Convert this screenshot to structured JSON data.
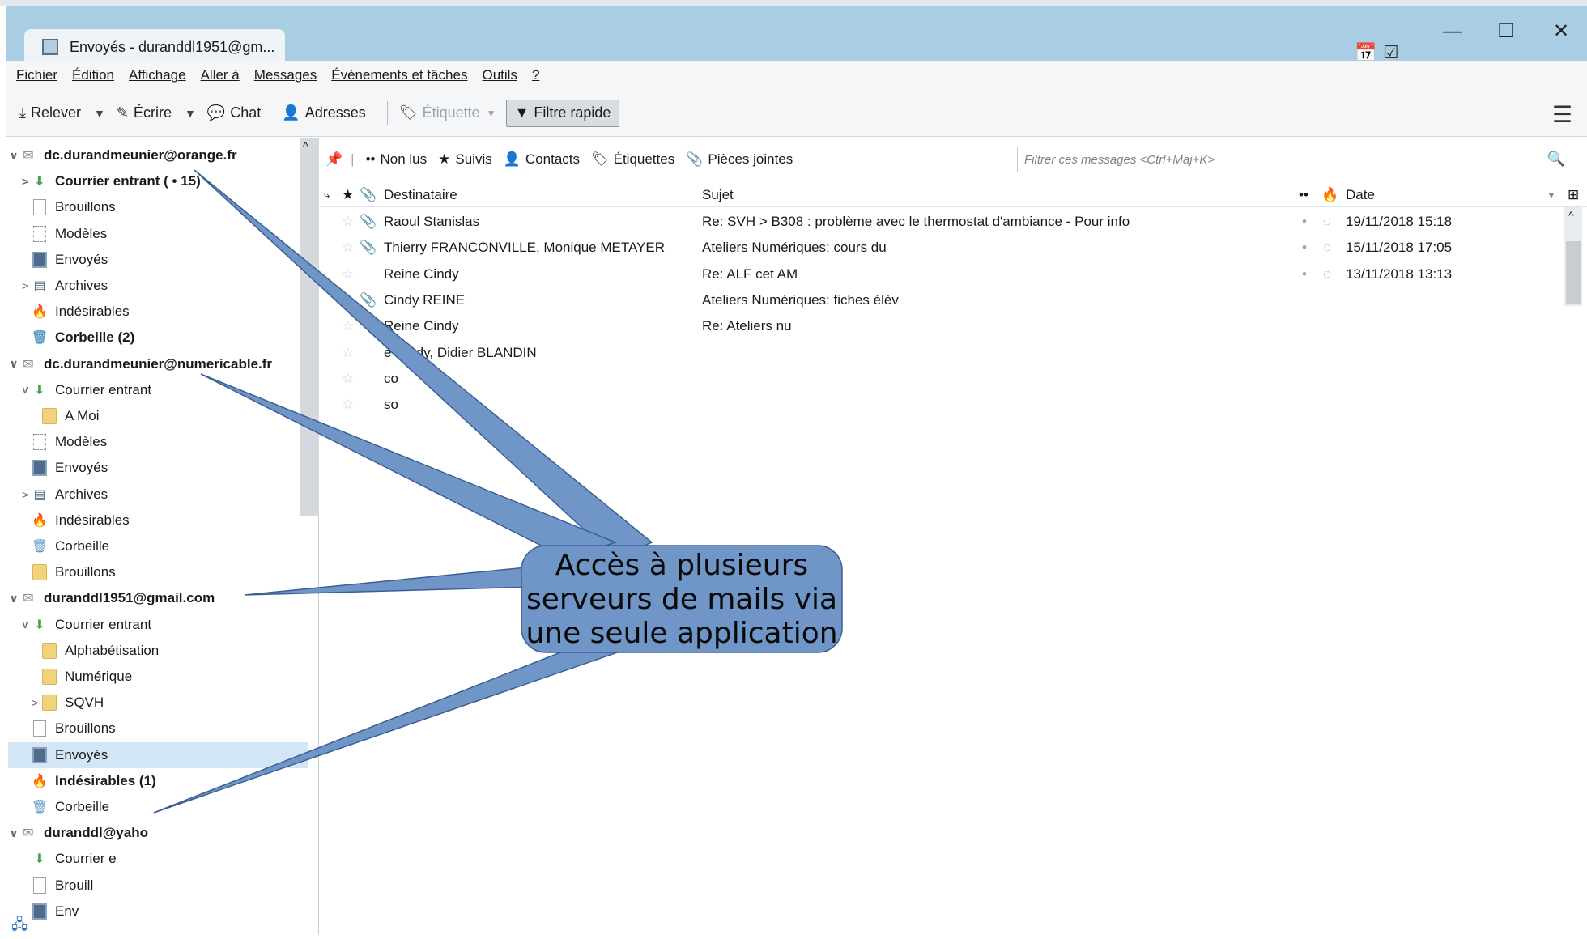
{
  "window": {
    "tab_title": "Envoyés - duranddl1951@gm...",
    "minimize": "—",
    "maximize": "☐",
    "close": "✕"
  },
  "menubar": {
    "items": [
      "Fichier",
      "Édition",
      "Affichage",
      "Aller à",
      "Messages",
      "Évènements et tâches",
      "Outils",
      "?"
    ]
  },
  "toolbar": {
    "get_mail": "Relever",
    "write": "Écrire",
    "chat": "Chat",
    "address_book": "Adresses",
    "tag": "Étiquette",
    "quick_filter": "Filtre rapide"
  },
  "folders": [
    {
      "label": "dc.durandmeunier@orange.fr",
      "type": "account",
      "twisty": "∨",
      "icon": "mail-icon"
    },
    {
      "label": "Courrier entrant ( • 15)",
      "type": "inbox",
      "twisty": ">",
      "bold": true
    },
    {
      "label": "Brouillons",
      "type": "drafts"
    },
    {
      "label": "Modèles",
      "type": "templates"
    },
    {
      "label": "Envoyés",
      "type": "sent"
    },
    {
      "label": "Archives",
      "type": "archives",
      "twisty": ">"
    },
    {
      "label": "Indésirables",
      "type": "junk"
    },
    {
      "label": "Corbeille (2)",
      "type": "trash",
      "bold": true
    },
    {
      "label": "dc.durandmeunier@numericable.fr",
      "type": "account",
      "twisty": "∨"
    },
    {
      "label": "Courrier entrant",
      "type": "inbox",
      "twisty": "∨"
    },
    {
      "label": "A Moi",
      "type": "folder",
      "indent": 1
    },
    {
      "label": "Modèles",
      "type": "templates"
    },
    {
      "label": "Envoyés",
      "type": "sent"
    },
    {
      "label": "Archives",
      "type": "archives",
      "twisty": ">"
    },
    {
      "label": "Indésirables",
      "type": "junk"
    },
    {
      "label": "Corbeille",
      "type": "trash"
    },
    {
      "label": "Brouillons",
      "type": "folder"
    },
    {
      "label": "duranddl1951@gmail.com",
      "type": "account",
      "twisty": "∨"
    },
    {
      "label": "Courrier entrant",
      "type": "inbox",
      "twisty": "∨"
    },
    {
      "label": "Alphabétisation",
      "type": "folder",
      "indent": 1
    },
    {
      "label": "Numérique",
      "type": "folder",
      "indent": 1
    },
    {
      "label": "SQVH",
      "type": "folder",
      "indent": 1,
      "twisty": ">"
    },
    {
      "label": "Brouillons",
      "type": "drafts"
    },
    {
      "label": "Envoyés",
      "type": "sent",
      "selected": true
    },
    {
      "label": "Indésirables (1)",
      "type": "junk",
      "bold": true
    },
    {
      "label": "Corbeille",
      "type": "trash"
    },
    {
      "label": "duranddl@yaho",
      "type": "account",
      "twisty": "∨"
    },
    {
      "label": "Courrier e",
      "type": "inbox"
    },
    {
      "label": "Brouill",
      "type": "drafts"
    },
    {
      "label": "Env",
      "type": "sent"
    }
  ],
  "quickfilter": {
    "unread": "Non lus",
    "starred": "Suivis",
    "contacts": "Contacts",
    "tags": "Étiquettes",
    "attachments": "Pièces jointes",
    "search_placeholder": "Filtrer ces messages <Ctrl+Maj+K>"
  },
  "columns": {
    "recipient": "Destinataire",
    "subject": "Sujet",
    "date": "Date"
  },
  "messages": [
    {
      "recipient": "Raoul Stanislas",
      "subject": "Re: SVH > B308 : problème avec le thermostat d'ambiance - Pour info",
      "date": "19/11/2018 15:18",
      "attachment": true
    },
    {
      "recipient": "Thierry FRANCONVILLE, Monique METAYER",
      "subject": "Ateliers Numériques: cours du",
      "date": "15/11/2018 17:05",
      "attachment": true
    },
    {
      "recipient": "Reine Cindy",
      "subject": "Re: ALF cet AM",
      "date": "13/11/2018 13:13",
      "attachment": false
    },
    {
      "recipient": "Cindy REINE",
      "subject": "Ateliers Numériques: fiches élèv",
      "date": "",
      "attachment": true
    },
    {
      "recipient": "Reine Cindy",
      "subject": "Re: Ateliers nu",
      "date": "",
      "attachment": false
    },
    {
      "recipient": "e Cindy, Didier BLANDIN",
      "subject": "",
      "date": "",
      "attachment": false
    },
    {
      "recipient": "co",
      "subject": "",
      "date": "",
      "attachment": false
    },
    {
      "recipient": "so",
      "subject": "",
      "date": "",
      "attachment": false
    }
  ],
  "callout": {
    "text_lines": [
      "Accès à plusieurs",
      "serveurs de mails via",
      "une seule application"
    ],
    "fill_color": "#7096c8",
    "stroke_color": "#3a5f94"
  }
}
